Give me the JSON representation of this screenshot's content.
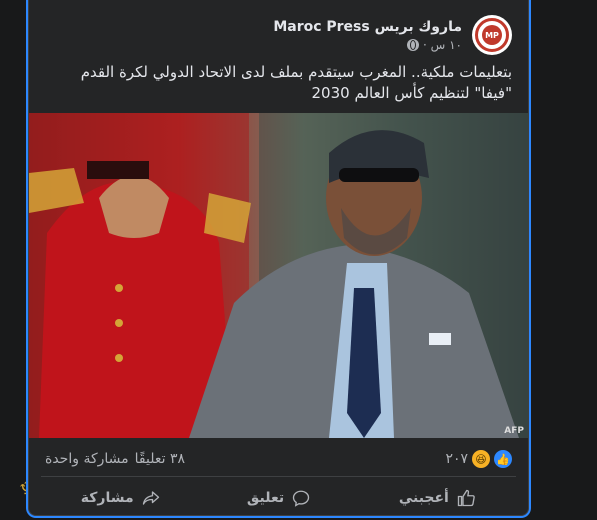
{
  "post": {
    "page_name": "ماروك بريس Maroc Press",
    "time": "١٠ س ·",
    "avatar_text": "MP",
    "caption": "بتعليمات ملكية.. المغرب سيتقدم بملف لدى الاتحاد الدولي لكرة القدم \"فيفا\" لتنظيم كأس العالم 2030",
    "photo_credit": "AFP"
  },
  "stats": {
    "reactions_count": "٢٠٧",
    "comments": "٣٨ تعليقًا",
    "shares": "مشاركة واحدة"
  },
  "actions": {
    "like": "أعجبني",
    "comment": "تعليق",
    "share": "مشاركة"
  },
  "colors": {
    "accent": "#2d88ff",
    "card_bg": "#242526",
    "text": "#e4e6eb",
    "muted": "#b0b3b8"
  }
}
